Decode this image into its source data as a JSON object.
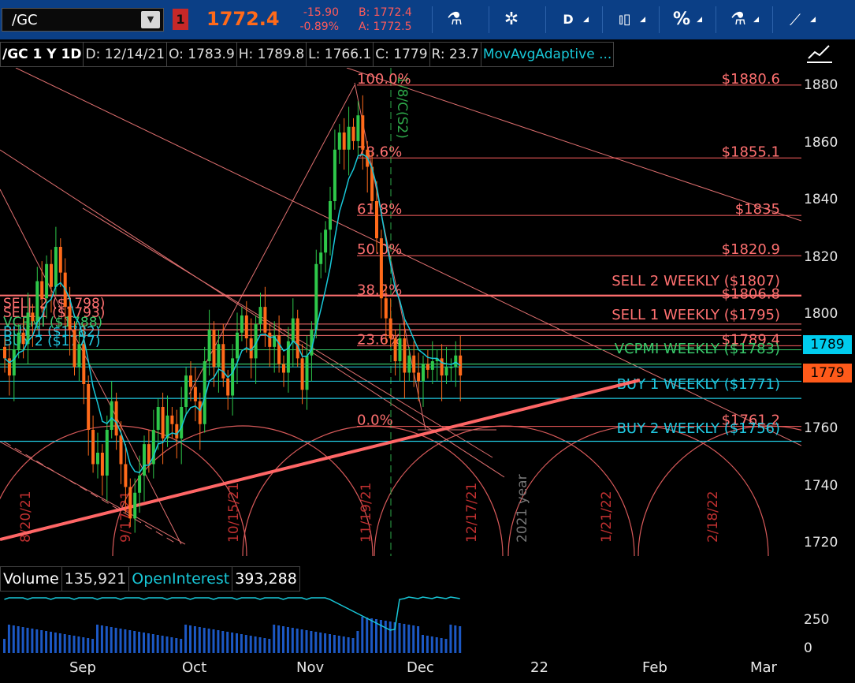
{
  "toolbar": {
    "symbol_input": "/GC",
    "badge": "1",
    "last_price": "1772.4",
    "net_change": "-15.90",
    "pct_change": "-0.89%",
    "bid": "B: 1772.4",
    "ask": "A: 1772.5",
    "aggregation": "D",
    "style_icon": "candle-icon",
    "percent": "%",
    "drawings_icon": "drawing-icon"
  },
  "info_bar": {
    "name": "/GC 1 Y 1D",
    "date": "D: 12/14/21",
    "open": "O: 1783.9",
    "high": "H: 1789.8",
    "low": "L: 1766.1",
    "close": "C: 1779",
    "range": "R: 23.7",
    "study": "MovAvgAdaptive ..."
  },
  "volume_bar": {
    "label": "Volume",
    "value": "135,921",
    "oi_label": "OpenInterest",
    "oi_value": "393,288"
  },
  "chart_data": {
    "type": "candlestick",
    "price_axis": {
      "ticks": [
        1880,
        1860,
        1840,
        1820,
        1800,
        1780,
        1760,
        1740,
        1720
      ],
      "range": [
        1714,
        1884
      ]
    },
    "volume_axis": {
      "ticks": [
        "250",
        "0"
      ]
    },
    "x_ticks": [
      "Sep",
      "Oct",
      "Nov",
      "Dec",
      "22",
      "Feb",
      "Mar"
    ],
    "current_price_box": "1779",
    "upper_price_box": "1789",
    "fib_levels": [
      {
        "label": "100.0%",
        "price": 1880.6,
        "price_label": "$1880.6"
      },
      {
        "label": "78.6%",
        "price": 1855.1,
        "price_label": "$1855.1"
      },
      {
        "label": "61.8%",
        "price": 1835,
        "price_label": "$1835"
      },
      {
        "label": "50.0%",
        "price": 1820.9,
        "price_label": "$1820.9"
      },
      {
        "label": "38.2%",
        "price": 1806.8,
        "price_label": "$1806.8"
      },
      {
        "label": "23.6%",
        "price": 1789.4,
        "price_label": "$1789.4"
      },
      {
        "label": "0.0%",
        "price": 1761.2,
        "price_label": "$1761.2"
      }
    ],
    "weekly_levels": [
      {
        "label": "SELL 2 WEEKLY ($1807)",
        "price": 1807,
        "color": "#ff7070"
      },
      {
        "label": "SELL 1 WEEKLY ($1795)",
        "price": 1795,
        "color": "#ff7070"
      },
      {
        "label": "VCPMI WEEKLY ($1783)",
        "price": 1783,
        "color": "#38c86a"
      },
      {
        "label": "BUY 1 WEEKLY ($1771)",
        "price": 1771,
        "color": "#20c8e0"
      },
      {
        "label": "BUY 2 WEEKLY ($1756)",
        "price": 1756,
        "color": "#20c8e0"
      }
    ],
    "daily_levels": [
      {
        "label": "SELL 2 ($1798)",
        "price": 1797,
        "color": "#ff7070"
      },
      {
        "label": "SELL 1 ($1793)",
        "price": 1793,
        "color": "#ff7070"
      },
      {
        "label": "VCPMI ($1788)",
        "price": 1788,
        "color": "#38c86a"
      },
      {
        "label": "BUY 1 ($1782)",
        "price": 1782,
        "color": "#20c8e0"
      },
      {
        "label": "BUY 2 ($1777)",
        "price": 1777,
        "color": "#20c8e0"
      }
    ],
    "cycle_dates": [
      "8/20/21",
      "9/17/21",
      "10/15/21",
      "11/19/21",
      "12/17/21",
      "2021 year",
      "1/21/22",
      "2/18/22"
    ],
    "cycle_label": "1/8/C(S2)",
    "closes": [
      1785,
      1779,
      1788,
      1794,
      1790,
      1801,
      1798,
      1812,
      1806,
      1818,
      1810,
      1824,
      1815,
      1803,
      1795,
      1782,
      1790,
      1776,
      1760,
      1748,
      1752,
      1744,
      1760,
      1770,
      1758,
      1748,
      1740,
      1729,
      1738,
      1744,
      1755,
      1748,
      1760,
      1768,
      1757,
      1765,
      1762,
      1757,
      1768,
      1779,
      1775,
      1770,
      1762,
      1784,
      1795,
      1782,
      1790,
      1778,
      1772,
      1785,
      1794,
      1800,
      1792,
      1785,
      1797,
      1803,
      1794,
      1789,
      1793,
      1783,
      1780,
      1791,
      1799,
      1785,
      1774,
      1786,
      1795,
      1818,
      1822,
      1830,
      1840,
      1858,
      1864,
      1858,
      1866,
      1861,
      1870,
      1858,
      1852,
      1840,
      1827,
      1806,
      1799,
      1792,
      1784,
      1792,
      1780,
      1786,
      1780,
      1777,
      1783,
      1781,
      1784,
      1785,
      1779,
      1782,
      1782,
      1786,
      1779
    ]
  }
}
